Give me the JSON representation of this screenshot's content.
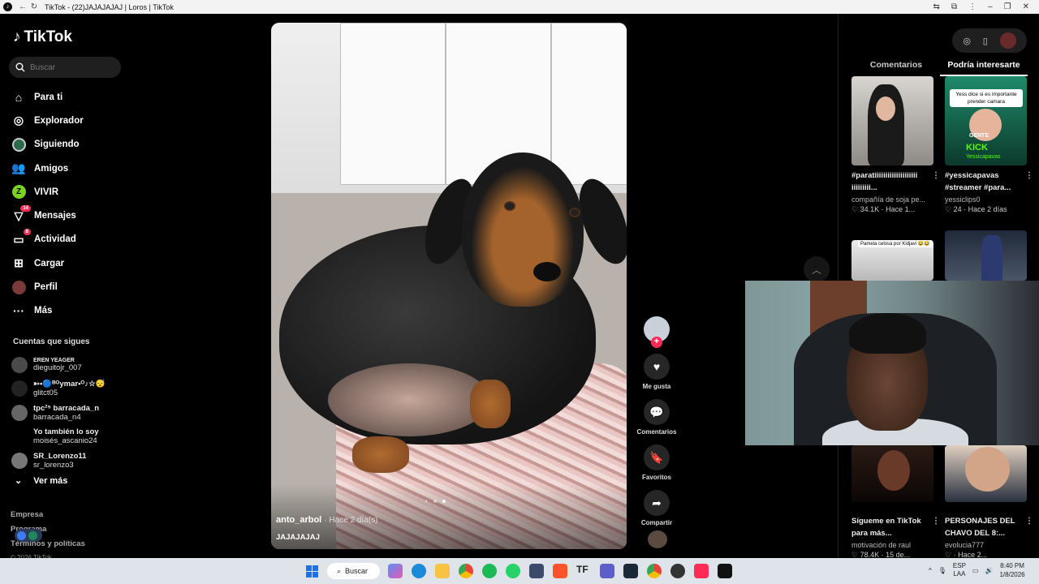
{
  "browser": {
    "tab_title": "TikTok - (22)JAJAJAJAJ | Loros | TikTok"
  },
  "sidebar": {
    "logo": "TikTok",
    "search_placeholder": "Buscar",
    "nav": [
      {
        "label": "Para ti",
        "icon": "home-icon"
      },
      {
        "label": "Explorador",
        "icon": "compass-icon"
      },
      {
        "label": "Siguiendo",
        "icon": "following-icon"
      },
      {
        "label": "Amigos",
        "icon": "friends-icon"
      },
      {
        "label": "VIVIR",
        "icon": "live-icon"
      },
      {
        "label": "Mensajes",
        "icon": "messages-icon",
        "badge": "14"
      },
      {
        "label": "Actividad",
        "icon": "activity-icon",
        "badge": "8"
      },
      {
        "label": "Cargar",
        "icon": "upload-icon"
      },
      {
        "label": "Perfil",
        "icon": "profile-icon"
      },
      {
        "label": "Más",
        "icon": "more-icon"
      }
    ],
    "following_heading": "Cuentas que sigues",
    "following": [
      {
        "name": "EREN YEAGER",
        "handle": "dieguitojr_007"
      },
      {
        "name": "➳•🔵ᴮᴼymar•ᴼ♪☆😴",
        "handle": "glitct05"
      },
      {
        "name": "tpc²⁵ barracada_n",
        "handle": "barracada_n4"
      },
      {
        "name": "Yo también lo soy",
        "handle": "moisés_ascanio24"
      },
      {
        "name": "SR_Lorenzo11",
        "handle": "sr_lorenzo3"
      }
    ],
    "see_more": "Ver más",
    "footer": [
      "Empresa",
      "Programa",
      "Términos y políticas"
    ],
    "copyright": "© 2026 TikTok"
  },
  "video": {
    "author": "anto_arbol",
    "time": "· Hace 2 día(s)",
    "caption": "JAJAJAJAJ"
  },
  "actions": {
    "like": "Me gusta",
    "comments": "Comentarios",
    "favorites": "Favoritos",
    "share": "Compartir"
  },
  "right_panel": {
    "tabs": [
      "Comentarios",
      "Podría interesarte"
    ],
    "cards": [
      {
        "title": "#paratiiiiiiiiiiiiiiiiiiii iiiiiiiii...",
        "user": "compañía de soja pe...",
        "stats": "♡ 34.1K · Hace 1..."
      },
      {
        "title": "#yessicapavas #streamer #para...",
        "user": "yessiclips0",
        "stats": "♡ 24 · Hace 2 días",
        "overlay": "Yess dice si es importante prender camara",
        "brand": "KICK",
        "brand_sub": "Yessicapavas",
        "tag": "GENTE"
      },
      {
        "title": "",
        "user": "",
        "stats": "",
        "overlay": "Pamela celosa por Kidjavi 😂😂"
      },
      {
        "title": "",
        "user": "",
        "stats": ""
      },
      {
        "title": "Sígueme en TikTok para más...",
        "user": "motivación de raul",
        "stats": "♡ 78.4K · 15 de..."
      },
      {
        "title": "PERSONAJES DEL CHAVO DEL 8:...",
        "user": "evolucia777",
        "stats": "♡ · Hace 2..."
      }
    ]
  },
  "taskbar": {
    "search": "Buscar",
    "lang": [
      "ESP",
      "LAA"
    ],
    "time": "8:40 PM",
    "date": "1/8/2026"
  },
  "colors": {
    "accent": "#fe2c55",
    "background": "#000000"
  }
}
